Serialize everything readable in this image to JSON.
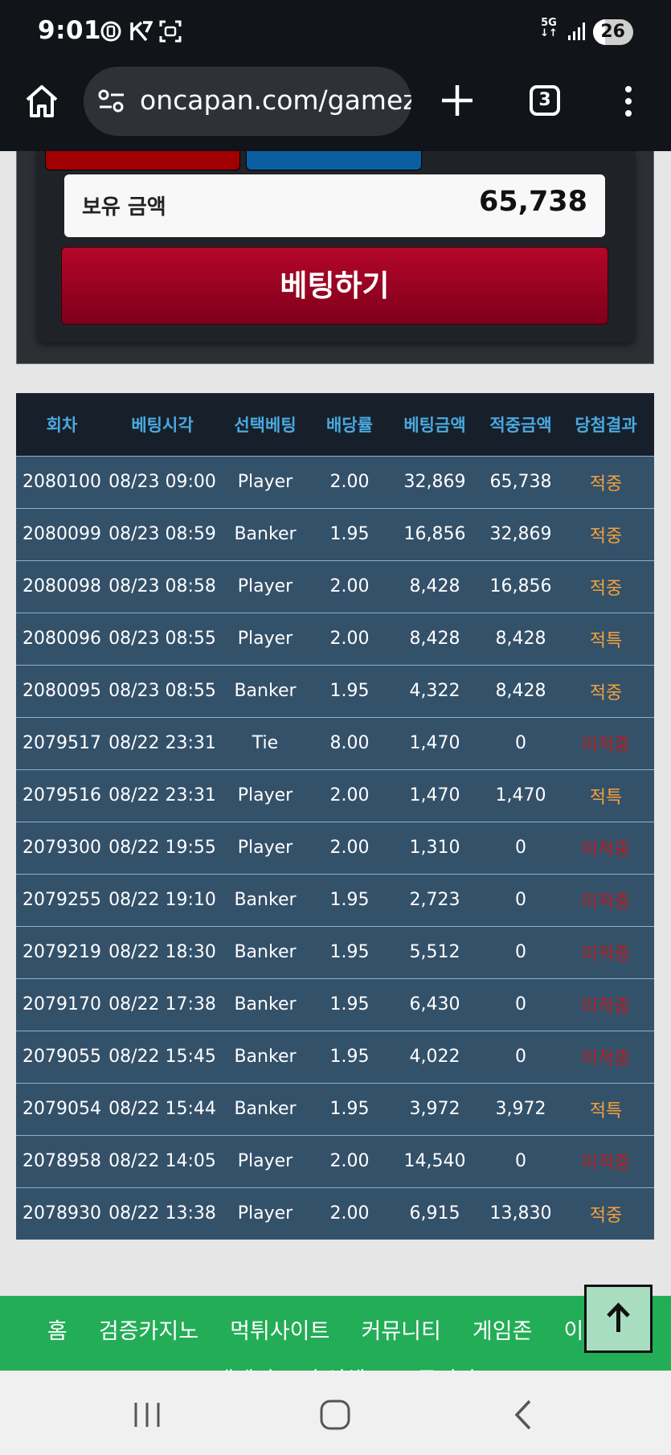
{
  "status_bar": {
    "time": "9:01",
    "network": "5G",
    "battery": "26"
  },
  "browser": {
    "url": "oncapan.com/gamez",
    "tab_count": "3"
  },
  "bet_panel": {
    "balance_label": "보유 금액",
    "balance_value": "65,738",
    "bet_button_label": "베팅하기"
  },
  "table": {
    "headers": [
      "회차",
      "베팅시각",
      "선택베팅",
      "배당률",
      "베팅금액",
      "적중금액",
      "당첨결과"
    ],
    "rows": [
      [
        "2080100",
        "08/23 09:00",
        "Player",
        "2.00",
        "32,869",
        "65,738",
        "적중"
      ],
      [
        "2080099",
        "08/23 08:59",
        "Banker",
        "1.95",
        "16,856",
        "32,869",
        "적중"
      ],
      [
        "2080098",
        "08/23 08:58",
        "Player",
        "2.00",
        "8,428",
        "16,856",
        "적중"
      ],
      [
        "2080096",
        "08/23 08:55",
        "Player",
        "2.00",
        "8,428",
        "8,428",
        "적특"
      ],
      [
        "2080095",
        "08/23 08:55",
        "Banker",
        "1.95",
        "4,322",
        "8,428",
        "적중"
      ],
      [
        "2079517",
        "08/22 23:31",
        "Tie",
        "8.00",
        "1,470",
        "0",
        "미적중"
      ],
      [
        "2079516",
        "08/22 23:31",
        "Player",
        "2.00",
        "1,470",
        "1,470",
        "적특"
      ],
      [
        "2079300",
        "08/22 19:55",
        "Player",
        "2.00",
        "1,310",
        "0",
        "미적중"
      ],
      [
        "2079255",
        "08/22 19:10",
        "Banker",
        "1.95",
        "2,723",
        "0",
        "미적중"
      ],
      [
        "2079219",
        "08/22 18:30",
        "Banker",
        "1.95",
        "5,512",
        "0",
        "미적중"
      ],
      [
        "2079170",
        "08/22 17:38",
        "Banker",
        "1.95",
        "6,430",
        "0",
        "미적중"
      ],
      [
        "2079055",
        "08/22 15:45",
        "Banker",
        "1.95",
        "4,022",
        "0",
        "미적중"
      ],
      [
        "2079054",
        "08/22 15:44",
        "Banker",
        "1.95",
        "3,972",
        "3,972",
        "적특"
      ],
      [
        "2078958",
        "08/22 14:05",
        "Player",
        "2.00",
        "14,540",
        "0",
        "미적중"
      ],
      [
        "2078930",
        "08/22 13:38",
        "Player",
        "2.00",
        "6,915",
        "13,830",
        "적중"
      ]
    ]
  },
  "footer": {
    "row1": [
      "홈",
      "검증카지노",
      "먹튀사이트",
      "커뮤니티",
      "게임존",
      "이벤트"
    ],
    "row2": [
      "고객센터",
      "출석체크",
      "공지장"
    ]
  },
  "colors": {
    "win": "#f3a23a",
    "lose": "#b71c1c",
    "header_text": "#4aa9e0",
    "footer_bg": "#23ad57"
  }
}
